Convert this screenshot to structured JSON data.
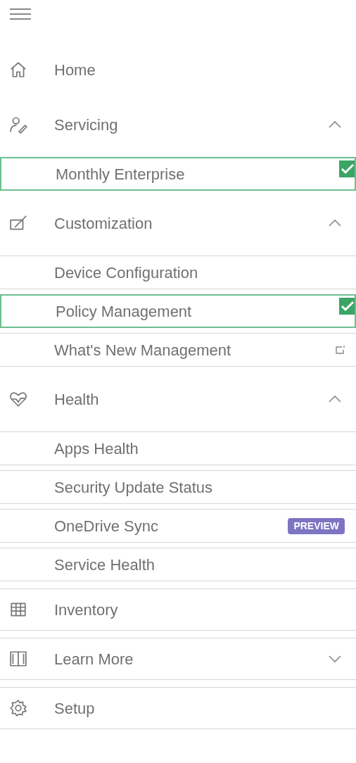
{
  "nav": [
    {
      "label": "Home",
      "kind": "link"
    },
    {
      "label": "Servicing",
      "kind": "group",
      "expanded": true,
      "children": [
        {
          "label": "Monthly Enterprise",
          "selected": true,
          "external": false
        }
      ]
    },
    {
      "label": "Customization",
      "kind": "group",
      "expanded": true,
      "children": [
        {
          "label": "Device Configuration",
          "selected": false,
          "external": false
        },
        {
          "label": "Policy Management",
          "selected": true,
          "external": false
        },
        {
          "label": "What's New Management",
          "selected": false,
          "external": true
        }
      ]
    },
    {
      "label": "Health",
      "kind": "group",
      "expanded": true,
      "children": [
        {
          "label": "Apps Health",
          "selected": false,
          "external": false
        },
        {
          "label": "Security Update Status",
          "selected": false,
          "external": false
        },
        {
          "label": "OneDrive Sync",
          "selected": false,
          "external": false,
          "badge": "PREVIEW"
        },
        {
          "label": "Service Health",
          "selected": false,
          "external": false
        }
      ]
    },
    {
      "label": "Inventory",
      "kind": "boxed-link"
    },
    {
      "label": "Learn More",
      "kind": "boxed-group",
      "expanded": false
    },
    {
      "label": "Setup",
      "kind": "boxed-link"
    }
  ]
}
